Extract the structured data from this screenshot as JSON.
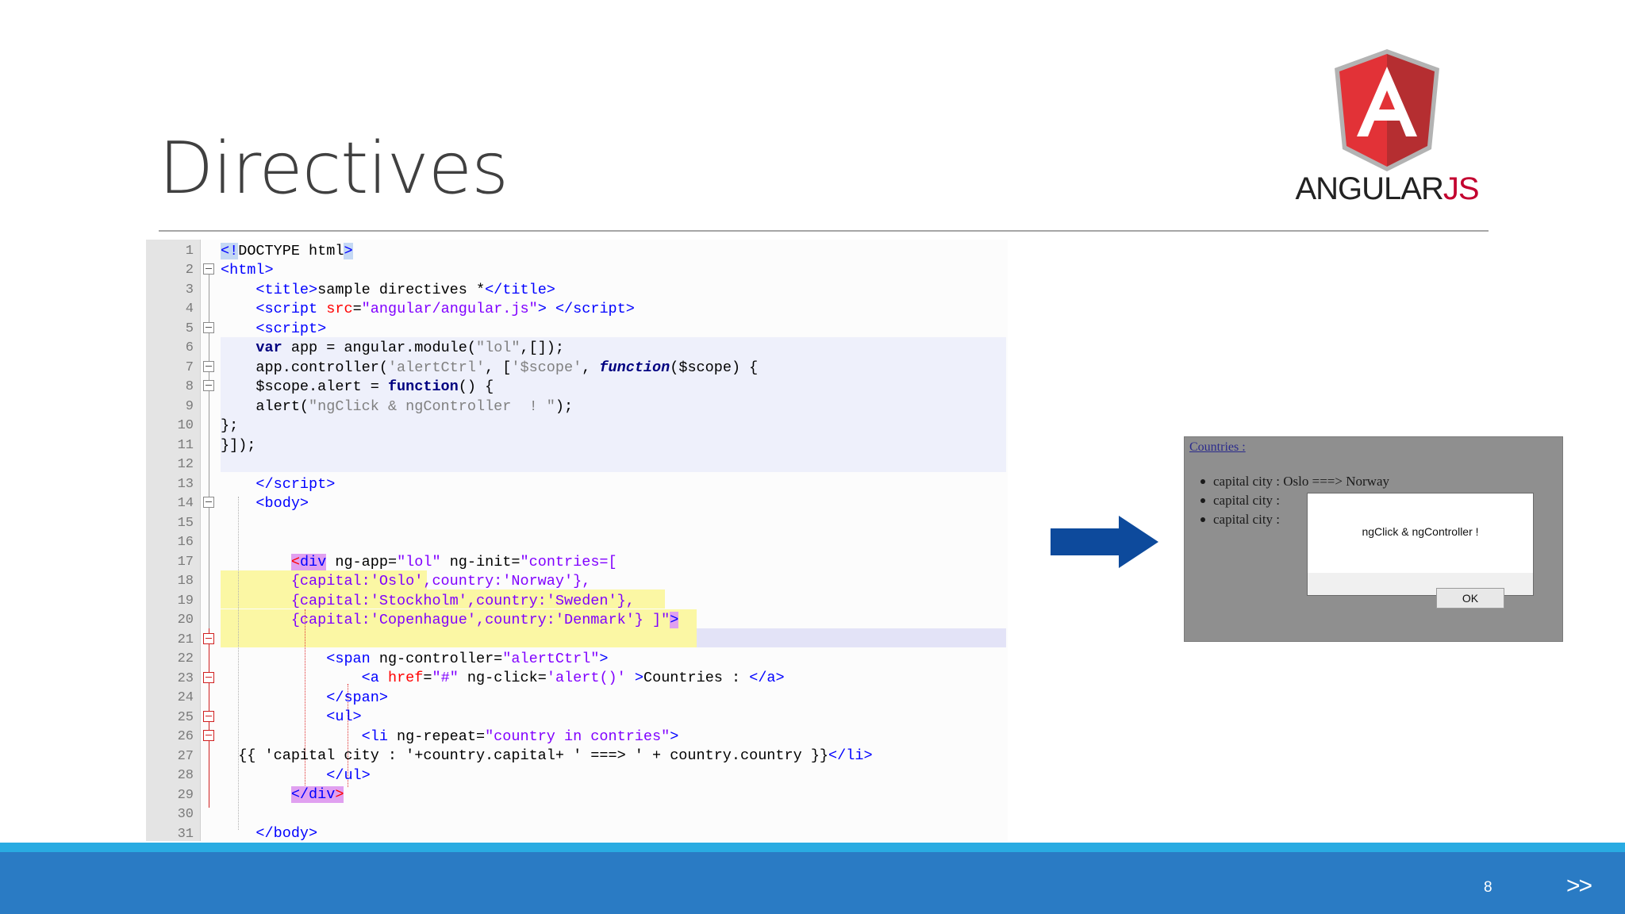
{
  "slide": {
    "title": "Directives",
    "page_number": "8",
    "next_label": ">>",
    "logo": {
      "prefix": "ANGULAR",
      "suffix": "JS",
      "letter": "A"
    }
  },
  "code": {
    "line_numbers": [
      "1",
      "2",
      "3",
      "4",
      "5",
      "6",
      "7",
      "8",
      "9",
      "10",
      "11",
      "12",
      "13",
      "14",
      "15",
      "16",
      "17",
      "18",
      "19",
      "20",
      "21",
      "22",
      "23",
      "24",
      "25",
      "26",
      "27",
      "28",
      "29",
      "30",
      "31"
    ]
  },
  "preview": {
    "link": "Countries :",
    "items": [
      "capital city : Oslo ===> Norway",
      "capital city :",
      "capital city :"
    ],
    "dialog_message": "ngClick & ngController  !",
    "ok_label": "OK"
  },
  "colors": {
    "footer": "#2a7bc4",
    "footer_accent": "#29abe2",
    "arrow": "#0d4a9c",
    "angular_red": "#dd1b16"
  }
}
